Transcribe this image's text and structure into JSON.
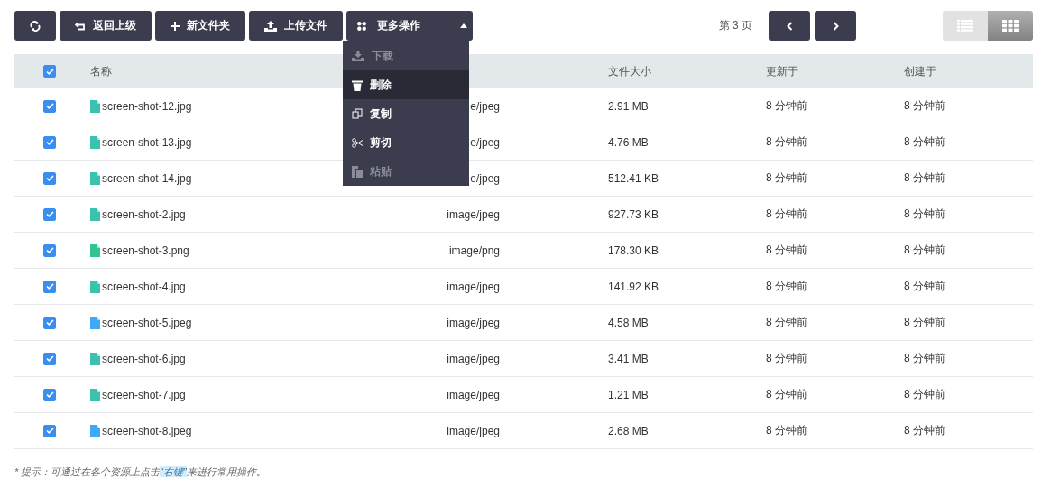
{
  "toolbar": {
    "buttons": [
      {
        "kind": "refresh"
      },
      {
        "kind": "back",
        "label": "返回上级"
      },
      {
        "kind": "add",
        "label": "新文件夹"
      },
      {
        "kind": "upload",
        "label": "上传文件"
      }
    ],
    "more": {
      "label": "更多操作",
      "expanded": true,
      "items": [
        {
          "kind": "download",
          "label": "下载",
          "disabled": true,
          "selected": false
        },
        {
          "kind": "delete",
          "label": "删除",
          "disabled": false,
          "selected": true
        },
        {
          "kind": "copy",
          "label": "复制",
          "disabled": false,
          "selected": false
        },
        {
          "kind": "cut",
          "label": "剪切",
          "disabled": false,
          "selected": false
        },
        {
          "kind": "paste",
          "label": "粘贴",
          "disabled": true,
          "selected": false
        }
      ]
    }
  },
  "pager": {
    "label": "第 3 页"
  },
  "view_toggle": [
    {
      "kind": "list",
      "selected": false
    },
    {
      "kind": "grid",
      "selected": true
    }
  ],
  "table": {
    "all_checked": true,
    "columns": [
      "名称",
      "文件大小",
      "更新于",
      "创建于"
    ],
    "rows": [
      {
        "checked": true,
        "kind": "jpg",
        "name": "screen-shot-12.jpg",
        "type": "e/jpeg",
        "size": "2.91 MB",
        "updated": "8 分钟前",
        "created": "8 分钟前"
      },
      {
        "checked": true,
        "kind": "jpg",
        "name": "screen-shot-13.jpg",
        "type": "e/jpeg",
        "size": "4.76 MB",
        "updated": "8 分钟前",
        "created": "8 分钟前"
      },
      {
        "checked": true,
        "kind": "jpg",
        "name": "screen-shot-14.jpg",
        "type": "e/jpeg",
        "size": "512.41 KB",
        "updated": "8 分钟前",
        "created": "8 分钟前"
      },
      {
        "checked": true,
        "kind": "jpg",
        "name": "screen-shot-2.jpg",
        "type": "image/jpeg",
        "size": "927.73 KB",
        "updated": "8 分钟前",
        "created": "8 分钟前"
      },
      {
        "checked": true,
        "kind": "png",
        "name": "screen-shot-3.png",
        "type": "image/png",
        "size": "178.30 KB",
        "updated": "8 分钟前",
        "created": "8 分钟前"
      },
      {
        "checked": true,
        "kind": "jpg",
        "name": "screen-shot-4.jpg",
        "type": "image/jpeg",
        "size": "141.92 KB",
        "updated": "8 分钟前",
        "created": "8 分钟前"
      },
      {
        "checked": true,
        "kind": "jpeg",
        "name": "screen-shot-5.jpeg",
        "type": "image/jpeg",
        "size": "4.58 MB",
        "updated": "8 分钟前",
        "created": "8 分钟前"
      },
      {
        "checked": true,
        "kind": "jpg",
        "name": "screen-shot-6.jpg",
        "type": "image/jpeg",
        "size": "3.41 MB",
        "updated": "8 分钟前",
        "created": "8 分钟前"
      },
      {
        "checked": true,
        "kind": "jpg",
        "name": "screen-shot-7.jpg",
        "type": "image/jpeg",
        "size": "1.21 MB",
        "updated": "8 分钟前",
        "created": "8 分钟前"
      },
      {
        "checked": true,
        "kind": "jpeg",
        "name": "screen-shot-8.jpeg",
        "type": "image/jpeg",
        "size": "2.68 MB",
        "updated": "8 分钟前",
        "created": "8 分钟前"
      }
    ]
  },
  "hint": {
    "before": "* 提示：可通过在各个资源上点击",
    "highlight": "“右键”",
    "after": "来进行常用操作。"
  }
}
